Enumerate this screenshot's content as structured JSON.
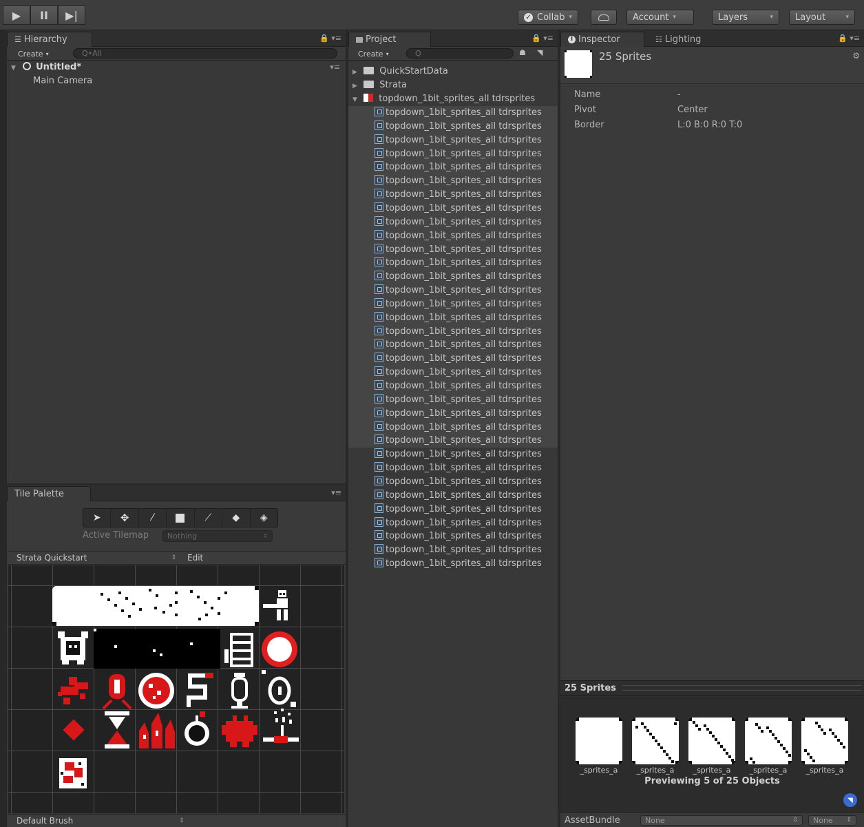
{
  "toolbar": {
    "collab": "Collab",
    "account": "Account",
    "layers": "Layers",
    "layout": "Layout",
    "caret": "▾"
  },
  "hierarchy": {
    "tab": "Hierarchy",
    "create": "Create",
    "search_placeholder": "Q•All",
    "scene": "Untitled*",
    "items": [
      "Main Camera"
    ]
  },
  "tile_palette": {
    "tab": "Tile Palette",
    "active_tilemap_label": "Active Tilemap",
    "active_tilemap_value": "Nothing",
    "palette": "Strata Quickstart",
    "edit": "Edit",
    "brush": "Default Brush"
  },
  "project": {
    "tab": "Project",
    "create": "Create",
    "search_placeholder": "Q",
    "folders": [
      "QuickStartData",
      "Strata"
    ],
    "asset": "topdown_1bit_sprites_all tdrsprites",
    "child_label": "topdown_1bit_sprites_all tdrsprites"
  },
  "inspector": {
    "tab": "Inspector",
    "lighting_tab": "Lighting",
    "title": "25 Sprites",
    "props": [
      {
        "label": "Name",
        "value": "-"
      },
      {
        "label": "Pivot",
        "value": "Center"
      },
      {
        "label": "Border",
        "value": "L:0 B:0 R:0 T:0"
      }
    ],
    "preview_header": "25 Sprites",
    "preview_labels": [
      "_sprites_a",
      "_sprites_a",
      "_sprites_a",
      "_sprites_a",
      "_sprites_a"
    ],
    "previewing": "Previewing 5 of 25 Objects",
    "assetbundle_label": "AssetBundle",
    "assetbundle_value": "None",
    "assetbundle_variant": "None"
  }
}
